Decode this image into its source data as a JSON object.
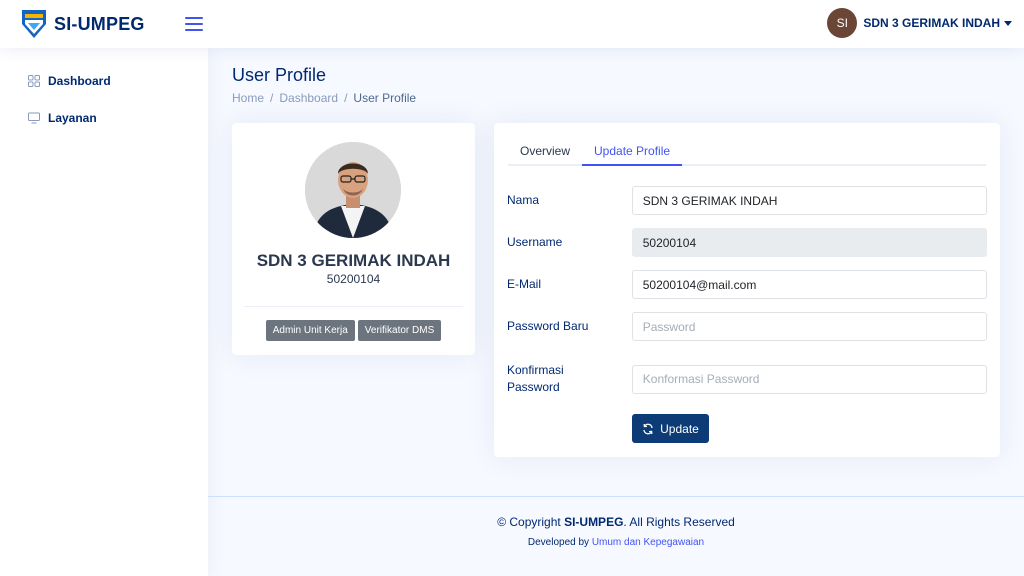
{
  "app": {
    "name": "SI-UMPEG"
  },
  "header": {
    "user": {
      "initials": "SI",
      "name": "SDN 3 GERIMAK INDAH"
    }
  },
  "sidebar": {
    "items": [
      {
        "label": "Dashboard",
        "icon": "grid-icon"
      },
      {
        "label": "Layanan",
        "icon": "monitor-icon"
      }
    ]
  },
  "page": {
    "title": "User Profile",
    "breadcrumb": [
      "Home",
      "Dashboard",
      "User Profile"
    ]
  },
  "profile_card": {
    "name": "SDN 3 GERIMAK INDAH",
    "id": "50200104",
    "roles": [
      "Admin Unit Kerja",
      "Verifikator DMS"
    ]
  },
  "form": {
    "tabs": [
      "Overview",
      "Update Profile"
    ],
    "active_tab": "Update Profile",
    "fields": {
      "nama": {
        "label": "Nama",
        "value": "SDN 3 GERIMAK INDAH"
      },
      "username": {
        "label": "Username",
        "value": "50200104"
      },
      "email": {
        "label": "E-Mail",
        "value": "50200104@mail.com"
      },
      "password": {
        "label": "Password Baru",
        "placeholder": "Password"
      },
      "confirm": {
        "label": "Konfirmasi Password",
        "placeholder": "Konformasi Password"
      }
    },
    "submit_label": "Update"
  },
  "footer": {
    "copyright_prefix": "© Copyright ",
    "copyright_brand": "SI-UMPEG",
    "copyright_suffix": ". All Rights Reserved",
    "developed_prefix": "Developed by ",
    "developed_link": "Umum dan Kepegawaian"
  },
  "colors": {
    "primary": "#4154f1",
    "navy": "#012970",
    "button": "#0d3b75",
    "badge": "#6c757d",
    "background": "#f6f9ff"
  }
}
